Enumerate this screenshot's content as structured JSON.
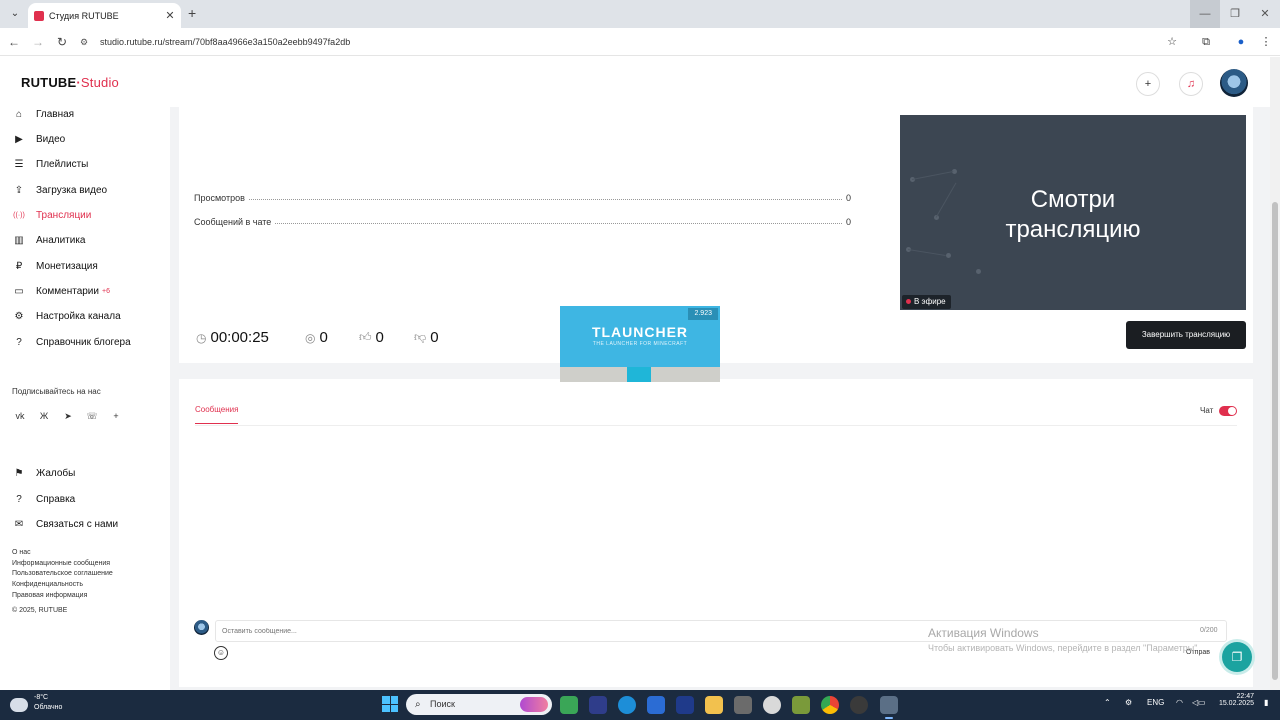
{
  "browser": {
    "tab_title": "Студия RUTUBE",
    "url": "studio.rutube.ru/stream/70bf8aa4966e3a150a2eebb9497fa2db"
  },
  "header": {
    "logo_main": "RUTUBE",
    "logo_studio": "Studio"
  },
  "sidebar": {
    "items": [
      {
        "label": "Главная",
        "icon": "home-icon",
        "glyph": "⌂"
      },
      {
        "label": "Видео",
        "icon": "video-icon",
        "glyph": "▶"
      },
      {
        "label": "Плейлисты",
        "icon": "playlist-icon",
        "glyph": "☰"
      },
      {
        "label": "Загрузка видео",
        "icon": "upload-icon",
        "glyph": "⇪"
      },
      {
        "label": "Трансляции",
        "icon": "broadcast-icon",
        "glyph": "((·))"
      },
      {
        "label": "Аналитика",
        "icon": "analytics-icon",
        "glyph": "▥"
      },
      {
        "label": "Монетизация",
        "icon": "monetization-icon",
        "glyph": "₽"
      },
      {
        "label": "Комментарии",
        "icon": "comments-icon",
        "glyph": "▭",
        "badge": "+6"
      },
      {
        "label": "Настройка канала",
        "icon": "channel-settings-icon",
        "glyph": "⚙"
      },
      {
        "label": "Справочник блогера",
        "icon": "guide-icon",
        "glyph": "?"
      }
    ],
    "subscribe_title": "Подписывайтесь на нас",
    "socials": [
      "vk-icon",
      "ok-icon",
      "telegram-icon",
      "viber-icon",
      "more-icon"
    ],
    "bottom_items": [
      {
        "label": "Жалобы",
        "icon": "flag-icon",
        "glyph": "⚑"
      },
      {
        "label": "Справка",
        "icon": "help-icon",
        "glyph": "?"
      },
      {
        "label": "Связаться с нами",
        "icon": "mail-icon",
        "glyph": "✉"
      }
    ],
    "footer_links": [
      "О нас",
      "Информационные сообщения",
      "Пользовательское соглашение",
      "Конфиденциальность",
      "Правовая информация",
      "© 2025, RUTUBE"
    ]
  },
  "stats": {
    "views_label": "Просмотров",
    "views_value": "0",
    "chat_messages_label": "Сообщений в чате",
    "chat_messages_value": "0",
    "duration": "00:00:25",
    "viewers": "0",
    "likes": "0",
    "dislikes": "0"
  },
  "preview": {
    "text_line1": "Смотри",
    "text_line2": "трансляцию",
    "live_label": "В эфире"
  },
  "end_button_label": "Завершить трансляцию",
  "chat": {
    "tab_label": "Сообщения",
    "toggle_label": "Чат",
    "input_placeholder": "Оставить сообщение...",
    "char_count": "0/200",
    "send_label": "Отправ"
  },
  "overlay": {
    "version": "2.923",
    "title": "TLAUNCHER",
    "subtitle": "THE LAUNCHER FOR MINECRAFT"
  },
  "watermark": {
    "line1": "Активация Windows",
    "line2": "Чтобы активировать Windows, перейдите в раздел \"Параметры\""
  },
  "taskbar": {
    "temperature": "-8°C",
    "weather": "Облачно",
    "search_label": "Поиск",
    "language": "ENG",
    "time": "22:47",
    "date": "15.02.2025"
  },
  "colors": {
    "accent": "#e0304e",
    "end_button": "#1b1e22",
    "taskbar": "#1b2b40",
    "support": "#1ba3a0"
  }
}
